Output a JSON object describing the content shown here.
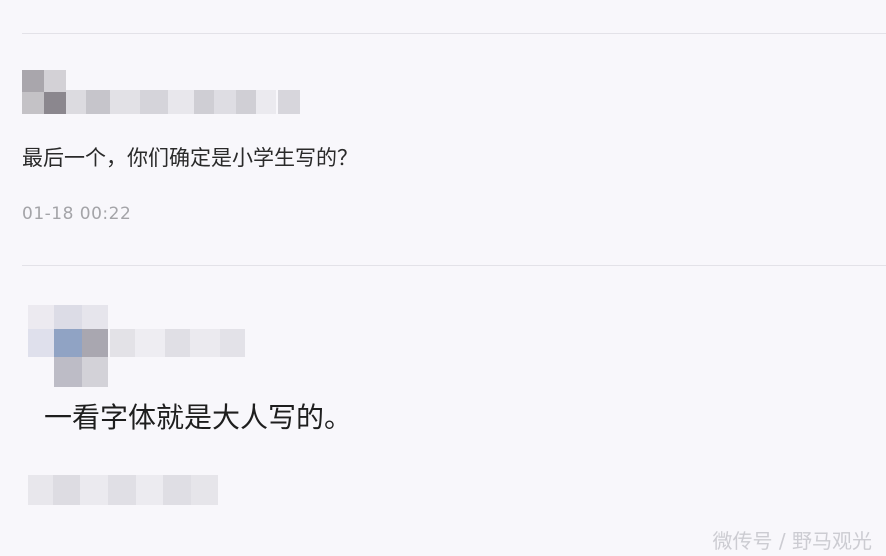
{
  "comments": [
    {
      "text": "最后一个，你们确定是小学生写的？",
      "timestamp": "01-18 00:22"
    },
    {
      "text": "一看字体就是大人写的。"
    }
  ],
  "watermark": "微传号 / 野马观光",
  "colors": {
    "background": "#f8f7fb",
    "divider": "#e3e2e8",
    "text": "#2a2a2a",
    "timestamp": "#a4a4a8"
  }
}
